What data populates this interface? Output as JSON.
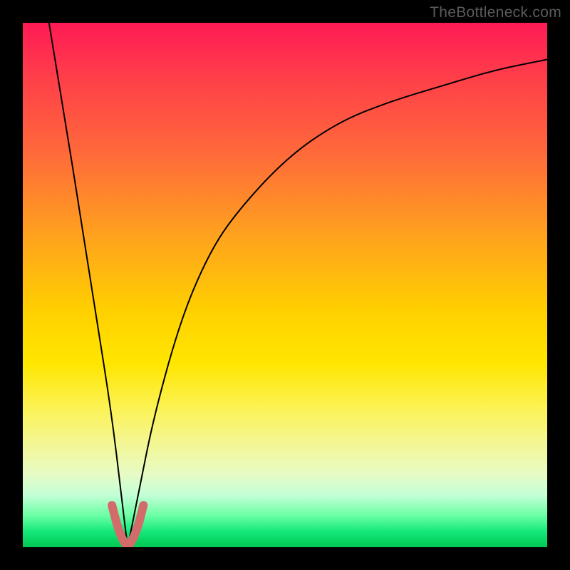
{
  "watermark": {
    "text": "TheBottleneck.com"
  },
  "colors": {
    "page_bg": "#000000",
    "gradient_top": "#ff1a55",
    "gradient_mid": "#ffd000",
    "gradient_bottom": "#00c851",
    "curve": "#000000",
    "valley_accent": "#d36b6b"
  },
  "chart_data": {
    "type": "line",
    "title": "",
    "xlabel": "",
    "ylabel": "",
    "xlim": [
      0,
      100
    ],
    "ylim": [
      0,
      100
    ],
    "grid": false,
    "legend": false,
    "description": "V-shaped bottleneck curve on a rainbow heat gradient. Minimum near x≈20. Left branch is a near-vertical line from the top-left corner down to the minimum. Right branch rises with diminishing slope (roughly like a sqrt/log curve) toward the upper-right.",
    "minimum_x": 20,
    "series": [
      {
        "name": "left_branch",
        "x": [
          5,
          8,
          11,
          14,
          17,
          19,
          20
        ],
        "values": [
          100,
          82,
          63,
          44,
          25,
          8,
          0
        ]
      },
      {
        "name": "right_branch",
        "x": [
          20,
          22,
          25,
          30,
          35,
          40,
          50,
          60,
          70,
          80,
          90,
          100
        ],
        "values": [
          0,
          10,
          25,
          43,
          55,
          63,
          74,
          81,
          85,
          88,
          91,
          93
        ]
      },
      {
        "name": "valley_highlight",
        "x": [
          17,
          18,
          19,
          20,
          21,
          22,
          23
        ],
        "values": [
          8,
          4,
          1.5,
          0,
          1.5,
          4,
          8
        ]
      }
    ]
  }
}
